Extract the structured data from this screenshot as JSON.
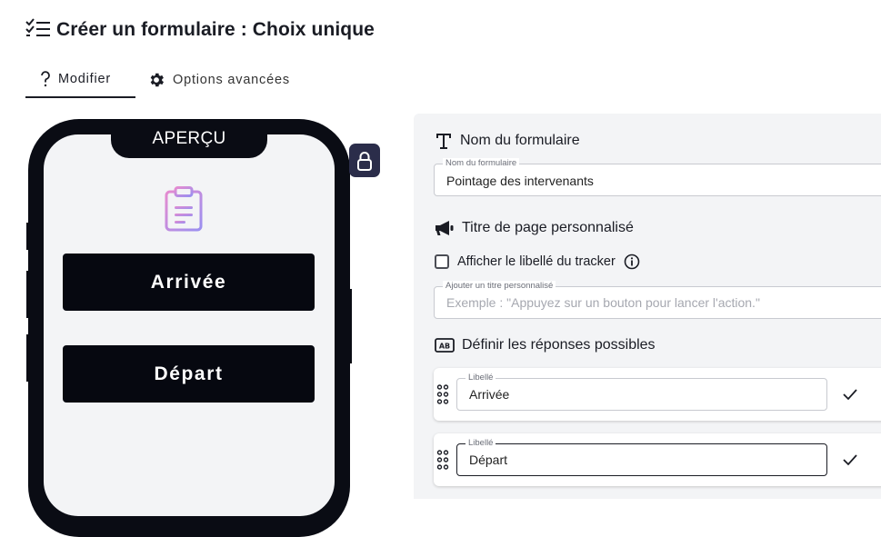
{
  "header": {
    "title": "Créer un formulaire : Choix unique",
    "icon": "checklist-icon"
  },
  "tabs": [
    {
      "label": "Modifier",
      "icon": "question-icon",
      "active": true
    },
    {
      "label": "Options avancées",
      "icon": "gear-icon",
      "active": false
    }
  ],
  "preview": {
    "label": "APERÇU",
    "icon": "clipboard-icon",
    "buttons": [
      "Arrivée",
      "Départ"
    ],
    "lock_icon": "lock-icon"
  },
  "form": {
    "name_section": {
      "heading": "Nom du formulaire",
      "icon": "text-t-icon",
      "field_label": "Nom du formulaire",
      "value": "Pointage des intervenants"
    },
    "page_title_section": {
      "heading": "Titre de page personnalisé",
      "icon": "megaphone-icon",
      "checkbox_label": "Afficher le libellé du tracker",
      "checkbox_checked": false,
      "info_icon": "info-icon",
      "field_label": "Ajouter un titre personnalisé",
      "placeholder": "Exemple : \"Appuyez sur un bouton pour lancer l'action.\""
    },
    "answers_section": {
      "heading": "Définir les réponses possibles",
      "icon": "ab-icon",
      "answers": [
        {
          "field_label": "Libellé",
          "value": "Arrivée"
        },
        {
          "field_label": "Libellé",
          "value": "Départ"
        }
      ]
    }
  },
  "colors": {
    "dark": "#0a0c14",
    "panel": "#f3f4f6",
    "lock_bg": "#2b2d4a"
  }
}
